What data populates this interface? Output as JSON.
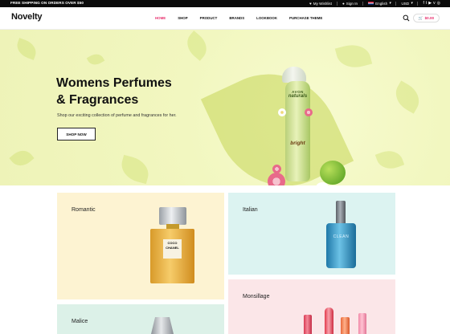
{
  "topbar": {
    "promo": "FREE SHIPPING ON ORDERS OVER $50",
    "wishlist": "My Wishlist",
    "signin": "Sign In",
    "language": "English",
    "currency": "USD",
    "social_icons": [
      "facebook-icon",
      "twitter-icon",
      "youtube-icon",
      "vimeo-icon",
      "instagram-icon"
    ]
  },
  "header": {
    "logo": "Novelty",
    "nav": [
      "HOME",
      "SHOP",
      "PRODUCT",
      "BRANDS",
      "LOOKBOOK",
      "PURCHASE THEME"
    ],
    "active_nav": "HOME",
    "cart_total": "$0.00",
    "accent_color": "#e8306e"
  },
  "hero": {
    "title_line1": "Womens Perfumes",
    "title_line2": "& Fragrances",
    "subtitle": "Shop our exciting collection of perfume and fragrances for her.",
    "button": "SHOP NOW",
    "bottle_brand": "AVON",
    "bottle_name": "naturals",
    "bottle_variant": "bright"
  },
  "categories": [
    {
      "label": "Romantic",
      "product_text_1": "COCO",
      "product_text_2": "CHANEL"
    },
    {
      "label": "Italian",
      "product_text_1": "CLEAN"
    },
    {
      "label": "Malice"
    },
    {
      "label": "Monsillage"
    }
  ]
}
